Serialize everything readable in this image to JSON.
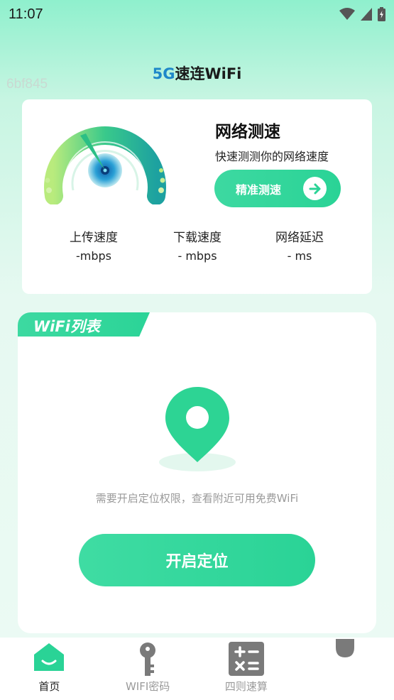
{
  "status_bar": {
    "time": "11:07"
  },
  "app": {
    "title_accent": "5G",
    "title_rest": "速连WiFi",
    "debug_id": "6bf845"
  },
  "speed_card": {
    "title": "网络测速",
    "subtitle": "快速测测你的网络速度",
    "button_label": "精准测速",
    "metrics": [
      {
        "label": "上传速度",
        "value": "-mbps"
      },
      {
        "label": "下载速度",
        "value": "- mbps"
      },
      {
        "label": "网络延迟",
        "value": "- ms"
      }
    ]
  },
  "wifi_card": {
    "tab_label": "WiFi列表",
    "hint": "需要开启定位权限，查看附近可用免费WiFi",
    "button_label": "开启定位"
  },
  "bottom_nav": {
    "items": [
      {
        "label": "首页",
        "icon": "home-icon",
        "active": true
      },
      {
        "label": "WIFI密码",
        "icon": "key-icon",
        "active": false
      },
      {
        "label": "四则速算",
        "icon": "calculator-icon",
        "active": false
      },
      {
        "label": "",
        "icon": "leaf-icon",
        "active": false
      }
    ]
  },
  "colors": {
    "accent": "#2ad396",
    "title_blue": "#1e88c9"
  }
}
